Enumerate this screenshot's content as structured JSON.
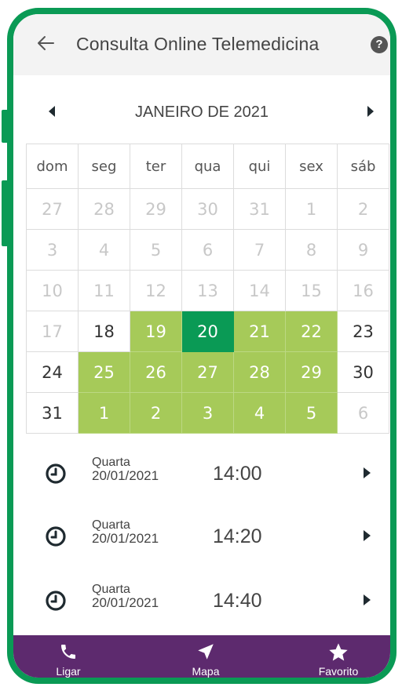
{
  "app": {
    "title": "Consulta Online Telemedicina"
  },
  "calendar": {
    "month_label": "JANEIRO DE 2021",
    "weekdays": [
      "dom",
      "seg",
      "ter",
      "qua",
      "qui",
      "sex",
      "sáb"
    ],
    "weeks": [
      [
        {
          "d": "27",
          "s": "other"
        },
        {
          "d": "28",
          "s": "other"
        },
        {
          "d": "29",
          "s": "other"
        },
        {
          "d": "30",
          "s": "other"
        },
        {
          "d": "31",
          "s": "other"
        },
        {
          "d": "1",
          "s": "other"
        },
        {
          "d": "2",
          "s": "other"
        }
      ],
      [
        {
          "d": "3",
          "s": "other"
        },
        {
          "d": "4",
          "s": "other"
        },
        {
          "d": "5",
          "s": "other"
        },
        {
          "d": "6",
          "s": "other"
        },
        {
          "d": "7",
          "s": "other"
        },
        {
          "d": "8",
          "s": "other"
        },
        {
          "d": "9",
          "s": "other"
        }
      ],
      [
        {
          "d": "10",
          "s": "other"
        },
        {
          "d": "11",
          "s": "other"
        },
        {
          "d": "12",
          "s": "other"
        },
        {
          "d": "13",
          "s": "other"
        },
        {
          "d": "14",
          "s": "other"
        },
        {
          "d": "15",
          "s": "other"
        },
        {
          "d": "16",
          "s": "other"
        }
      ],
      [
        {
          "d": "17",
          "s": "other"
        },
        {
          "d": "18",
          "s": "normal"
        },
        {
          "d": "19",
          "s": "avail"
        },
        {
          "d": "20",
          "s": "selected"
        },
        {
          "d": "21",
          "s": "avail"
        },
        {
          "d": "22",
          "s": "avail"
        },
        {
          "d": "23",
          "s": "normal"
        }
      ],
      [
        {
          "d": "24",
          "s": "normal"
        },
        {
          "d": "25",
          "s": "avail"
        },
        {
          "d": "26",
          "s": "avail"
        },
        {
          "d": "27",
          "s": "avail"
        },
        {
          "d": "28",
          "s": "avail"
        },
        {
          "d": "29",
          "s": "avail"
        },
        {
          "d": "30",
          "s": "normal"
        }
      ],
      [
        {
          "d": "31",
          "s": "normal"
        },
        {
          "d": "1",
          "s": "avail"
        },
        {
          "d": "2",
          "s": "avail"
        },
        {
          "d": "3",
          "s": "avail"
        },
        {
          "d": "4",
          "s": "avail"
        },
        {
          "d": "5",
          "s": "avail"
        },
        {
          "d": "6",
          "s": "other"
        }
      ]
    ]
  },
  "slots": [
    {
      "day": "Quarta",
      "date": "20/01/2021",
      "time": "14:00"
    },
    {
      "day": "Quarta",
      "date": "20/01/2021",
      "time": "14:20"
    },
    {
      "day": "Quarta",
      "date": "20/01/2021",
      "time": "14:40"
    }
  ],
  "bottom_nav": {
    "ligar": "Ligar",
    "mapa": "Mapa",
    "favorito": "Favorito"
  },
  "icons": {
    "back": "arrow-left-icon",
    "help": "question-circle-icon",
    "clock": "clock-icon",
    "phone": "phone-icon",
    "map": "navigation-arrow-icon",
    "star": "star-icon"
  },
  "colors": {
    "frame_green": "#0a9a55",
    "available_day": "#a6ca59",
    "selected_day": "#0a9a55",
    "bottom_nav": "#5d2a6e"
  }
}
